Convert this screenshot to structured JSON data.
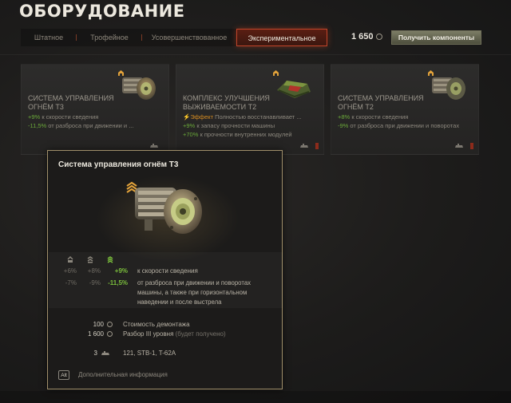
{
  "page": {
    "title": "ОБОРУДОВАНИЕ"
  },
  "tabs": [
    {
      "label": "Штатное"
    },
    {
      "label": "Трофейное"
    },
    {
      "label": "Усовершенствованное"
    },
    {
      "label": "Экспериментальное",
      "active": true
    }
  ],
  "balance": {
    "value": "1 650",
    "icon": "component-coin-icon"
  },
  "get_components_button": {
    "label": "Получить компоненты"
  },
  "cards": [
    {
      "name": "СИСТЕМА УПРАВЛЕНИЯ ОГНЁМ Т3",
      "lines": [
        {
          "value": "+9%",
          "text": " к скорости сведения"
        },
        {
          "value": "-11,5%",
          "text": " от разброса при движении и ..."
        }
      ]
    },
    {
      "name": "КОМПЛЕКС УЛУЧШЕНИЯ ВЫЖИВАЕМОСТИ Т2",
      "effect": {
        "value": "Эффект",
        "text": " Полностью восстанавливает ..."
      },
      "lines": [
        {
          "value": "+9%",
          "text": " к запасу прочности машины"
        },
        {
          "value": "+70%",
          "text": " к прочности внутренних модулей"
        }
      ]
    },
    {
      "name": "СИСТЕМА УПРАВЛЕНИЯ ОГНЁМ Т2",
      "lines": [
        {
          "value": "+8%",
          "text": " к скорости сведения"
        },
        {
          "value": "-9%",
          "text": " от разброса при движении и поворотах"
        }
      ]
    }
  ],
  "tooltip": {
    "title": "Система управления огнём Т3",
    "rows": [
      {
        "t1": "+6%",
        "t2": "+8%",
        "t3": "+9%",
        "text": "к скорости сведения"
      },
      {
        "t1": "-7%",
        "t2": "-9%",
        "t3": "-11,5%",
        "text": "от разброса при движении и поворотах машины, а также при горизонтальном наведении и после выстрела"
      }
    ],
    "dismantle_cost": {
      "value": "100",
      "label": "Стоимость демонтажа"
    },
    "disassembly": {
      "value": "1 600",
      "label": "Разбор III уровня",
      "note": " (будет получено)"
    },
    "vehicles": {
      "count": "3",
      "list": "121, STB-1, T-62A"
    },
    "alt_key": "Alt",
    "more_info": "Дополнительная информация"
  },
  "colors": {
    "accent_red": "#c0442a",
    "bonus_green": "#7bbf3c",
    "effect_orange": "#d28a22",
    "tier_gold": "#e2a23a"
  }
}
